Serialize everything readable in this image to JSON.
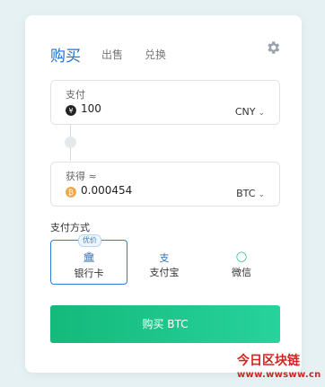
{
  "tabs": [
    {
      "label": "购买",
      "active": true
    },
    {
      "label": "出售",
      "active": false
    },
    {
      "label": "兑换",
      "active": false
    }
  ],
  "pay": {
    "label": "支付",
    "value": "100",
    "unit": "CNY",
    "coin_icon": "yen-icon"
  },
  "receive": {
    "label": "获得 ≈",
    "value": "0.000454",
    "unit": "BTC",
    "coin_icon": "bitcoin-icon"
  },
  "payment_section_title": "支付方式",
  "payment_methods": [
    {
      "label": "银行卡",
      "icon": "bank-icon",
      "icon_glyph": "🏛",
      "badge": "优价",
      "selected": true
    },
    {
      "label": "支付宝",
      "icon": "alipay-icon",
      "icon_glyph": "支",
      "selected": false
    },
    {
      "label": "微信",
      "icon": "wechat-icon",
      "icon_glyph": "◯",
      "selected": false
    }
  ],
  "buy_button": "购买 BTC",
  "watermark": {
    "line1": "今日区块链",
    "line2": "www.wwsww.cn"
  },
  "colors": {
    "accent": "#1f6fcf",
    "button_gradient_start": "#14b97b",
    "button_gradient_end": "#27d39c",
    "bitcoin": "#f2a54a",
    "yen_coin": "#222222",
    "watermark": "#d52222"
  }
}
